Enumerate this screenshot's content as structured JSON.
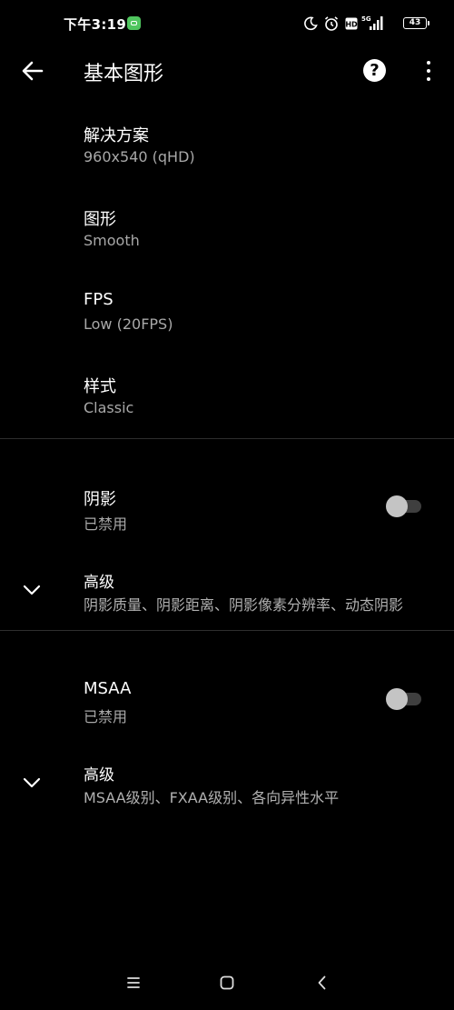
{
  "status_bar": {
    "time": "下午3:19",
    "battery": "43",
    "icons": [
      "moon-icon",
      "alarm-icon",
      "hd-icon",
      "5g-signal-icon",
      "battery-icon"
    ]
  },
  "app_bar": {
    "title": "基本图形",
    "icons": [
      "back-arrow-icon",
      "help-icon",
      "more-vert-icon"
    ]
  },
  "settings": {
    "resolution": {
      "title": "解决方案",
      "value": "960x540 (qHD)"
    },
    "graphics": {
      "title": "图形",
      "value": "Smooth"
    },
    "fps": {
      "title": "FPS",
      "value": "Low (20FPS)"
    },
    "style": {
      "title": "样式",
      "value": "Classic"
    }
  },
  "shadow": {
    "title": "阴影",
    "state": "已禁用",
    "enabled": false,
    "advanced": {
      "title": "高级",
      "summary": "阴影质量、阴影距离、阴影像素分辨率、动态阴影"
    }
  },
  "msaa": {
    "title": "MSAA",
    "state": "已禁用",
    "enabled": false,
    "advanced": {
      "title": "高级",
      "summary": "MSAA级别、FXAA级别、各向异性水平"
    }
  },
  "nav_bar": {
    "icons": [
      "menu-icon",
      "home-icon",
      "back-icon"
    ]
  },
  "colors": {
    "background": "#000000",
    "primary_text": "#ffffff",
    "secondary_text": "#a8a8a8",
    "toggle_off_track": "#3f3f3f",
    "toggle_off_thumb": "#c4c4c4",
    "notification_green": "#4fc55e"
  }
}
